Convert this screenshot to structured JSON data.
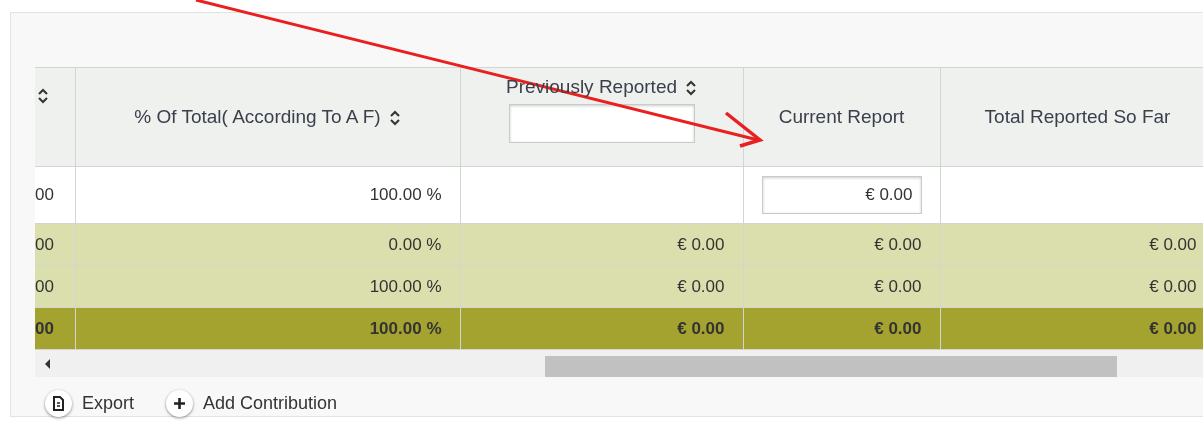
{
  "table": {
    "columns": [
      {
        "sortable": true,
        "filter": false
      },
      {
        "label": "% Of Total( According To A F)",
        "sortable": true,
        "filter": false
      },
      {
        "label": "Previously Reported",
        "sortable": true,
        "filter": true
      },
      {
        "label": "Current Report",
        "sortable": false,
        "filter": false
      },
      {
        "label": "Total Reported So Far",
        "sortable": false,
        "filter": false
      }
    ],
    "rows": [
      {
        "kind": "entry",
        "cells": [
          "00",
          "100.00 %",
          null,
          {
            "value": "€ 0.00"
          },
          null
        ]
      },
      {
        "kind": "subtotal",
        "cells": [
          "00",
          "0.00 %",
          "€ 0.00",
          "€ 0.00",
          "€ 0.00"
        ]
      },
      {
        "kind": "subtotal",
        "cells": [
          "00",
          "100.00 %",
          "€ 0.00",
          "€ 0.00",
          "€ 0.00"
        ]
      },
      {
        "kind": "total",
        "cells": [
          "00",
          "100.00 %",
          "€ 0.00",
          "€ 0.00",
          "€ 0.00"
        ]
      }
    ]
  },
  "actions": [
    {
      "label": "Export",
      "kind": "export"
    },
    {
      "label": "Add Contribution",
      "kind": "add"
    }
  ]
}
